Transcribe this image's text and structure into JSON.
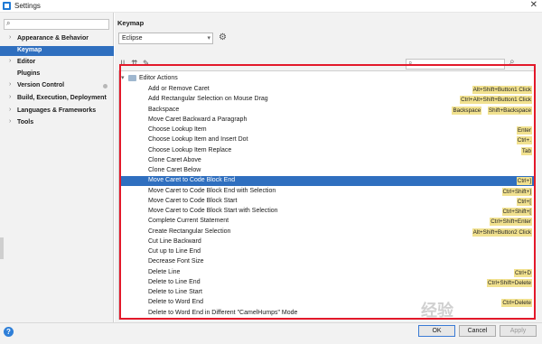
{
  "window": {
    "title": "Settings",
    "close_glyph": "✕"
  },
  "sidebar": {
    "search_placeholder": "",
    "items": [
      {
        "label": "Appearance & Behavior",
        "expandable": true,
        "selected": false
      },
      {
        "label": "Keymap",
        "expandable": false,
        "selected": true
      },
      {
        "label": "Editor",
        "expandable": true,
        "selected": false
      },
      {
        "label": "Plugins",
        "expandable": false,
        "selected": false
      },
      {
        "label": "Version Control",
        "expandable": true,
        "selected": false
      },
      {
        "label": "Build, Execution, Deployment",
        "expandable": true,
        "selected": false
      },
      {
        "label": "Languages & Frameworks",
        "expandable": true,
        "selected": false
      },
      {
        "label": "Tools",
        "expandable": true,
        "selected": false
      }
    ]
  },
  "main": {
    "title": "Keymap",
    "scheme": {
      "value": "Eclipse"
    },
    "search": {
      "value": ""
    },
    "tree": {
      "root_label": "Editor Actions",
      "selected_index": 10,
      "rows": [
        {
          "name": "Add or Remove Caret",
          "shortcuts": [
            "Alt+Shift+Button1 Click"
          ]
        },
        {
          "name": "Add Rectangular Selection on Mouse Drag",
          "shortcuts": [
            "Ctrl+Alt+Shift+Button1 Click"
          ]
        },
        {
          "name": "Backspace",
          "shortcuts": [
            "Backspace",
            "Shift+Backspace"
          ]
        },
        {
          "name": "Move Caret Backward a Paragraph",
          "shortcuts": []
        },
        {
          "name": "Choose Lookup Item",
          "shortcuts": [
            "Enter"
          ]
        },
        {
          "name": "Choose Lookup Item and Insert Dot",
          "shortcuts": [
            "Ctrl+."
          ]
        },
        {
          "name": "Choose Lookup Item Replace",
          "shortcuts": [
            "Tab"
          ]
        },
        {
          "name": "Clone Caret Above",
          "shortcuts": []
        },
        {
          "name": "Clone Caret Below",
          "shortcuts": []
        },
        {
          "name": "Move Caret to Code Block End",
          "shortcuts": [
            "Ctrl+]"
          ]
        },
        {
          "name": "Move Caret to Code Block End with Selection",
          "shortcuts": [
            "Ctrl+Shift+]"
          ]
        },
        {
          "name": "Move Caret to Code Block Start",
          "shortcuts": [
            "Ctrl+["
          ]
        },
        {
          "name": "Move Caret to Code Block Start with Selection",
          "shortcuts": [
            "Ctrl+Shift+["
          ]
        },
        {
          "name": "Complete Current Statement",
          "shortcuts": [
            "Ctrl+Shift+Enter"
          ]
        },
        {
          "name": "Create Rectangular Selection",
          "shortcuts": [
            "Alt+Shift+Button2 Click"
          ]
        },
        {
          "name": "Cut Line Backward",
          "shortcuts": []
        },
        {
          "name": "Cut up to Line End",
          "shortcuts": []
        },
        {
          "name": "Decrease Font Size",
          "shortcuts": []
        },
        {
          "name": "Delete Line",
          "shortcuts": [
            "Ctrl+D"
          ]
        },
        {
          "name": "Delete to Line End",
          "shortcuts": [
            "Ctrl+Shift+Delete"
          ]
        },
        {
          "name": "Delete to Line Start",
          "shortcuts": []
        },
        {
          "name": "Delete to Word End",
          "shortcuts": [
            "Ctrl+Delete"
          ]
        },
        {
          "name": "Delete to Word End in Different \"CamelHumps\" Mode",
          "shortcuts": []
        }
      ]
    }
  },
  "footer": {
    "help": "?",
    "ok": "OK",
    "cancel": "Cancel",
    "apply": "Apply"
  },
  "colors": {
    "selection": "#2f6fbf",
    "shortcut_bg": "#f1e18f",
    "highlight_border": "#e3192a"
  }
}
